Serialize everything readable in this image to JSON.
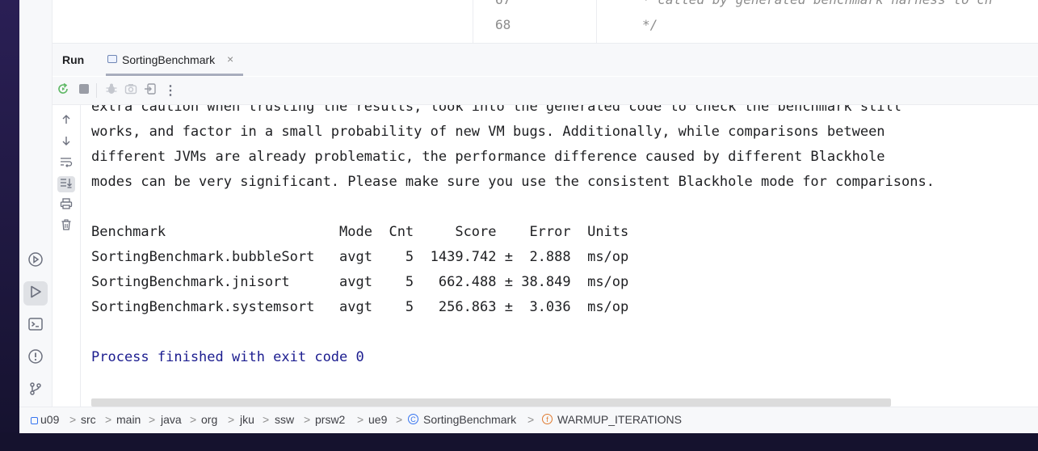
{
  "editor": {
    "line_numbers": [
      "67",
      "68"
    ],
    "code_lines": [
      "* called by generated benchmark harness to ch",
      "*/"
    ]
  },
  "run_panel": {
    "title": "Run",
    "tab_label": "SortingBenchmark",
    "tab_close": "×"
  },
  "toolbar": {
    "icons": [
      "rerun-icon",
      "stop-icon",
      "debug-icon",
      "camera-icon",
      "export-icon",
      "more-icon"
    ],
    "more_label": "⋮"
  },
  "side_actions": [
    "up-arrow-icon",
    "down-arrow-icon",
    "soft-wrap-icon",
    "scroll-to-end-icon",
    "print-icon",
    "trash-icon"
  ],
  "console": {
    "lines": [
      "extra caution when trusting the results, look into the generated code to check the benchmark still",
      "works, and factor in a small probability of new VM bugs. Additionally, while comparisons between",
      "different JVMs are already problematic, the performance difference caused by different Blackhole",
      "modes can be very significant. Please make sure you use the consistent Blackhole mode for comparisons.",
      "",
      "Benchmark                     Mode  Cnt     Score    Error  Units",
      "SortingBenchmark.bubbleSort   avgt    5  1439.742 ±  2.888  ms/op",
      "SortingBenchmark.jnisort      avgt    5   662.488 ± 38.849  ms/op",
      "SortingBenchmark.systemsort   avgt    5   256.863 ±  3.036  ms/op",
      "",
      "Process finished with exit code 0"
    ]
  },
  "left_bar": [
    "services-icon",
    "run-icon",
    "terminal-icon",
    "problems-icon",
    "git-icon"
  ],
  "breadcrumb": {
    "items": [
      "u09",
      "src",
      "main",
      "java",
      "org",
      "jku",
      "ssw",
      "prsw2",
      "ue9",
      "SortingBenchmark",
      "WARMUP_ITERATIONS"
    ],
    "separator": ">"
  },
  "colors": {
    "console_finished": "#1b1c8f",
    "class_icon": "#3574f0",
    "field_icon": "#e07a2f"
  }
}
